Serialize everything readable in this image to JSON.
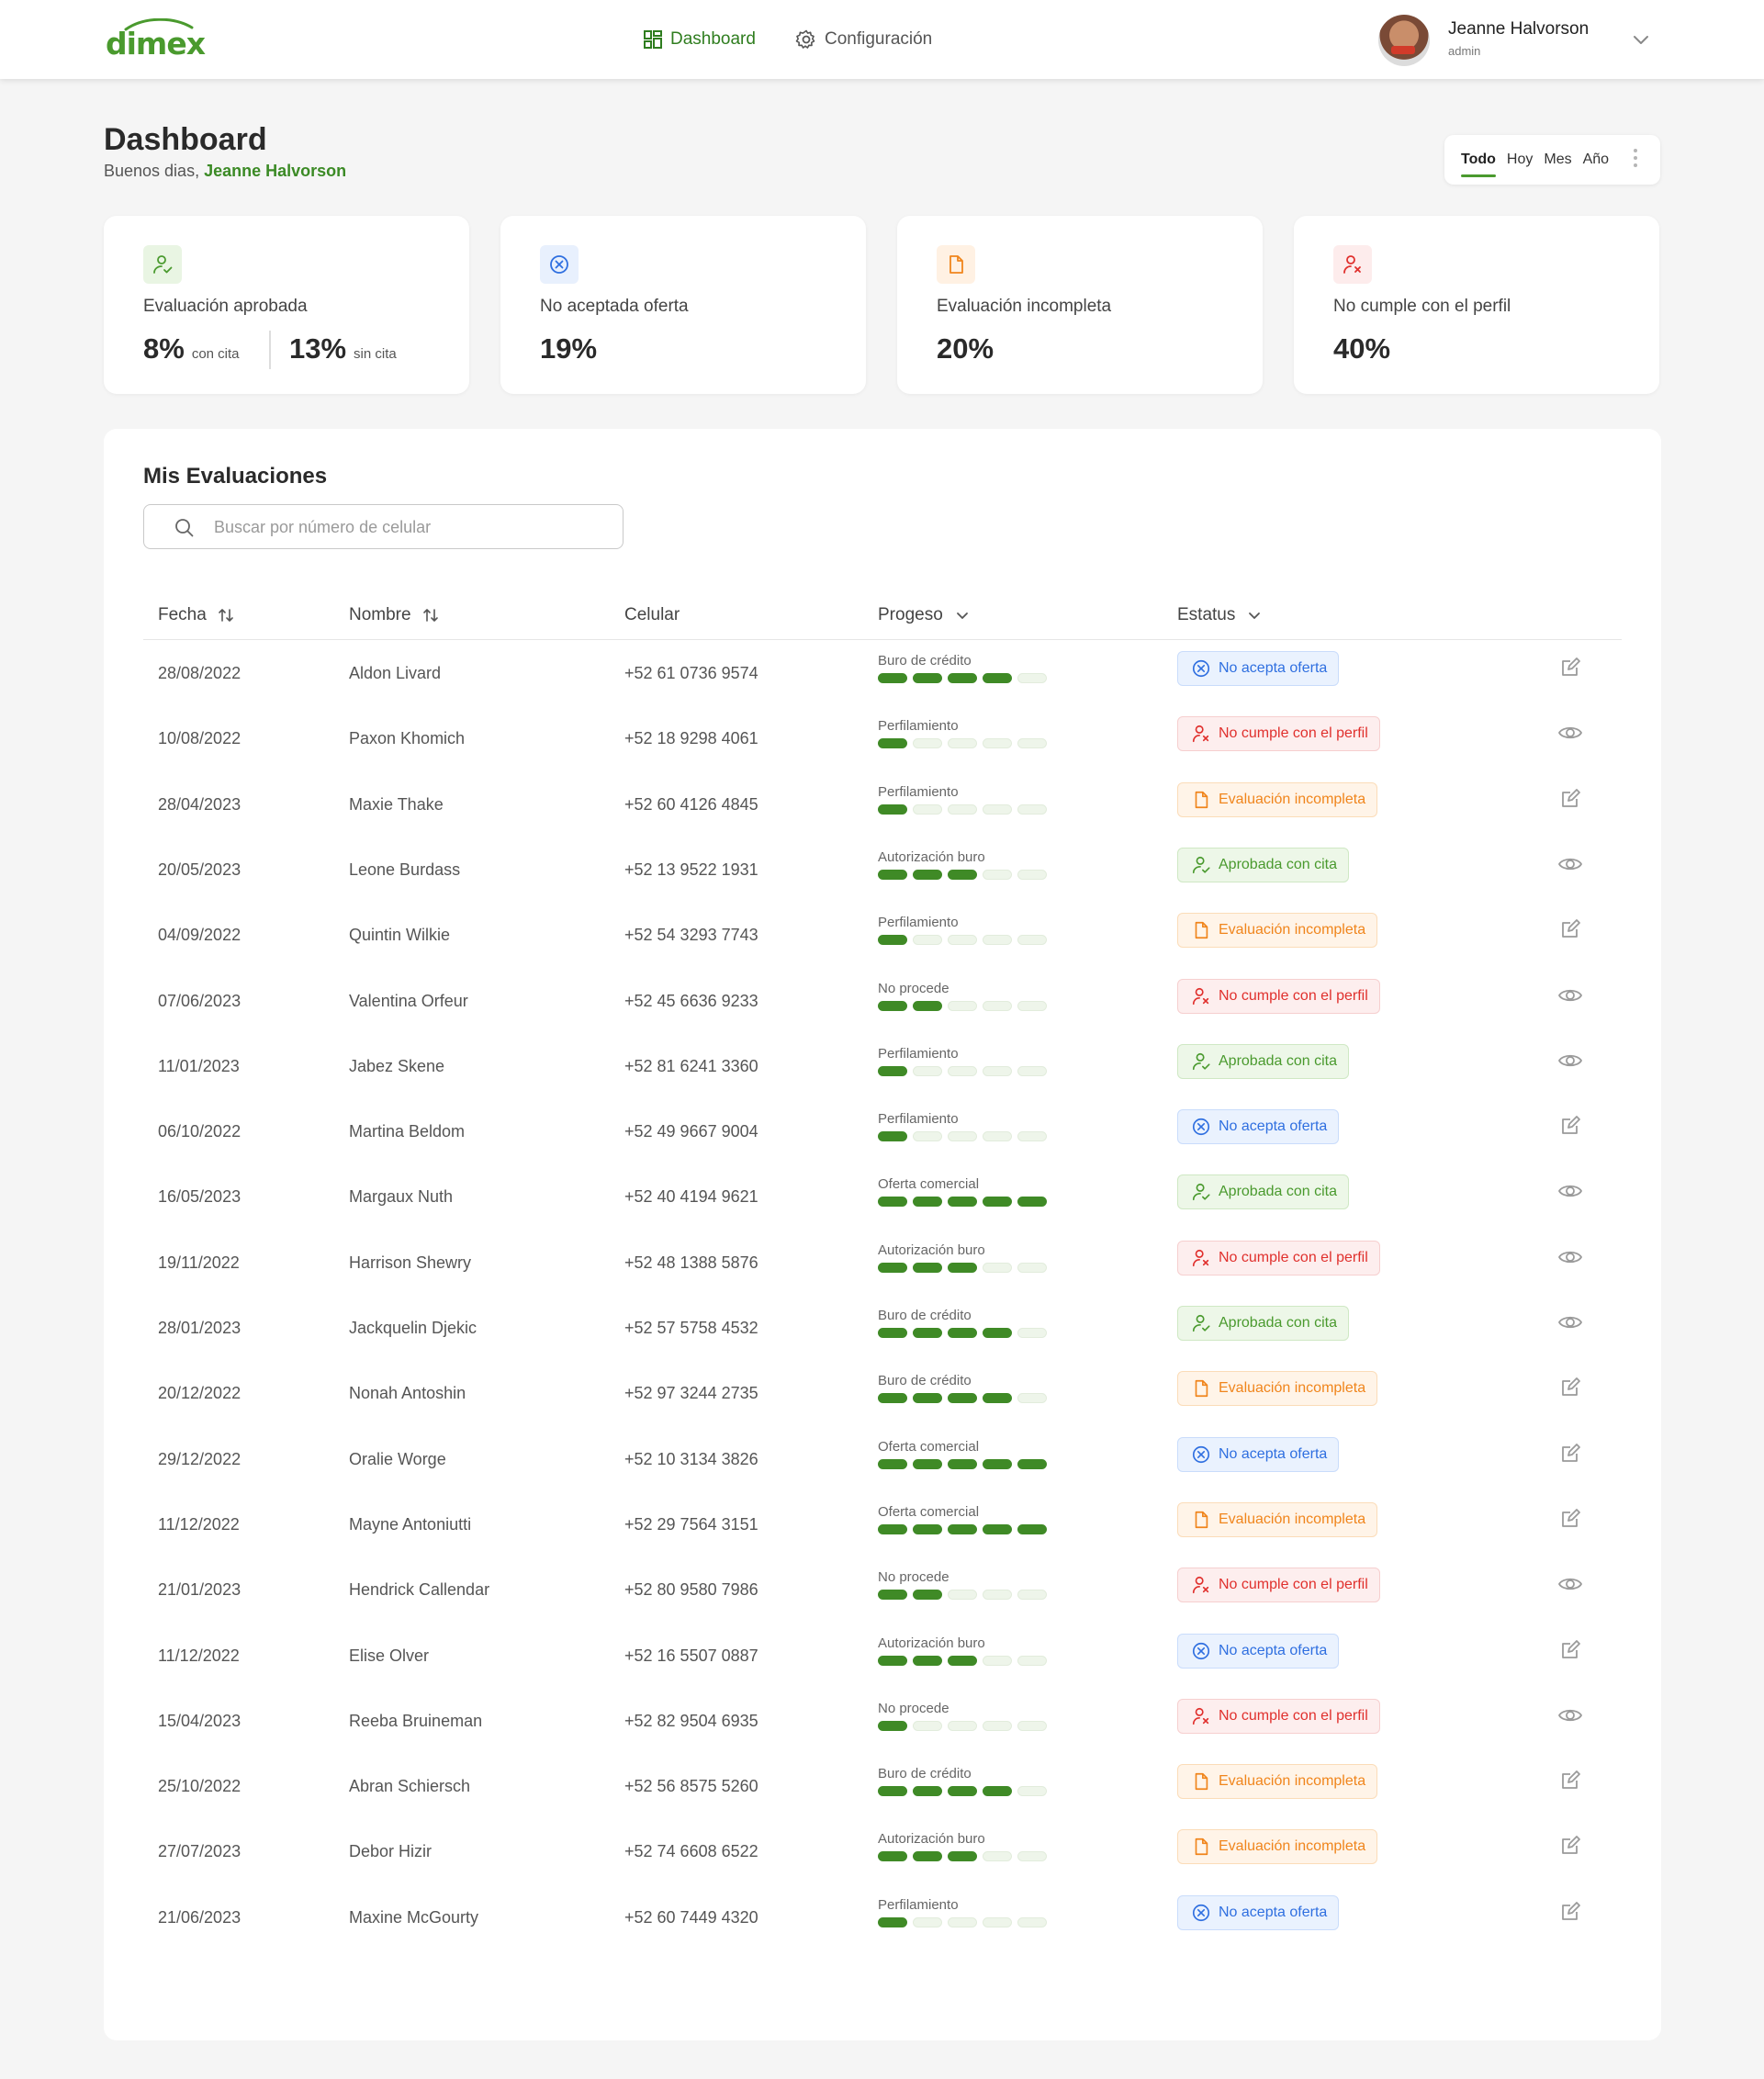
{
  "brand": {
    "name": "dimex",
    "color": "#4a9a2e"
  },
  "nav": {
    "items": [
      {
        "label": "Dashboard",
        "icon": "dashboard-grid-icon",
        "active": true
      },
      {
        "label": "Configuración",
        "icon": "gear-icon",
        "active": false
      }
    ]
  },
  "user": {
    "name": "Jeanne Halvorson",
    "role": "admin"
  },
  "header": {
    "title": "Dashboard",
    "greeting_prefix": "Buenos dias,",
    "greeting_name": "Jeanne Halvorson"
  },
  "period": {
    "options": [
      "Todo",
      "Hoy",
      "Mes",
      "Año"
    ],
    "selected": "Todo"
  },
  "stats": [
    {
      "label": "Evaluación aprobada",
      "icon": "user-check-icon",
      "color": "#4a9a2e",
      "value": "8%",
      "value_sub": "con cita",
      "value2": "13%",
      "value2_sub": "sin cita"
    },
    {
      "label": "No aceptada oferta",
      "icon": "x-circle-icon",
      "color": "#2f6fe0",
      "value": "19%"
    },
    {
      "label": "Evaluación incompleta",
      "icon": "document-icon",
      "color": "#f0851c",
      "value": "20%"
    },
    {
      "label": "No cumple con el perfil",
      "icon": "user-x-icon",
      "color": "#e0302d",
      "value": "40%"
    }
  ],
  "evaluations": {
    "title": "Mis Evaluaciones",
    "search_placeholder": "Buscar por número de celular",
    "columns": [
      "Fecha",
      "Nombre",
      "Celular",
      "Progeso",
      "Estatus"
    ],
    "progress_total_steps": 5,
    "rows": [
      {
        "fecha": "28/08/2022",
        "nombre": "Aldon Livard",
        "celular": "+52 61 0736 9574",
        "progreso": "Buro de crédito",
        "steps": 4,
        "estatus": "No acepta oferta",
        "tone": "blue",
        "action": "edit-icon"
      },
      {
        "fecha": "10/08/2022",
        "nombre": "Paxon Khomich",
        "celular": "+52 18 9298 4061",
        "progreso": "Perfilamiento",
        "steps": 1,
        "estatus": "No cumple con el perfil",
        "tone": "red",
        "action": "eye-icon"
      },
      {
        "fecha": "28/04/2023",
        "nombre": "Maxie Thake",
        "celular": "+52 60 4126 4845",
        "progreso": "Perfilamiento",
        "steps": 1,
        "estatus": "Evaluación incompleta",
        "tone": "orange",
        "action": "edit-icon"
      },
      {
        "fecha": "20/05/2023",
        "nombre": "Leone Burdass",
        "celular": "+52 13 9522 1931",
        "progreso": "Autorización buro",
        "steps": 3,
        "estatus": "Aprobada con cita",
        "tone": "green",
        "action": "eye-icon"
      },
      {
        "fecha": "04/09/2022",
        "nombre": "Quintin Wilkie",
        "celular": "+52 54 3293 7743",
        "progreso": "Perfilamiento",
        "steps": 1,
        "estatus": "Evaluación incompleta",
        "tone": "orange",
        "action": "edit-icon"
      },
      {
        "fecha": "07/06/2023",
        "nombre": "Valentina Orfeur",
        "celular": "+52 45 6636 9233",
        "progreso": "No procede",
        "steps": 2,
        "estatus": "No cumple con el perfil",
        "tone": "red",
        "action": "eye-icon"
      },
      {
        "fecha": "11/01/2023",
        "nombre": "Jabez Skene",
        "celular": "+52 81 6241 3360",
        "progreso": "Perfilamiento",
        "steps": 1,
        "estatus": "Aprobada con cita",
        "tone": "green",
        "action": "eye-icon"
      },
      {
        "fecha": "06/10/2022",
        "nombre": "Martina Beldom",
        "celular": "+52 49 9667 9004",
        "progreso": "Perfilamiento",
        "steps": 1,
        "estatus": "No acepta oferta",
        "tone": "blue",
        "action": "edit-icon"
      },
      {
        "fecha": "16/05/2023",
        "nombre": "Margaux Nuth",
        "celular": "+52 40 4194 9621",
        "progreso": "Oferta comercial",
        "steps": 5,
        "estatus": "Aprobada con cita",
        "tone": "green",
        "action": "eye-icon"
      },
      {
        "fecha": "19/11/2022",
        "nombre": "Harrison Shewry",
        "celular": "+52 48 1388 5876",
        "progreso": "Autorización buro",
        "steps": 3,
        "estatus": "No cumple con el perfil",
        "tone": "red",
        "action": "eye-icon"
      },
      {
        "fecha": "28/01/2023",
        "nombre": "Jackquelin Djekic",
        "celular": "+52 57 5758 4532",
        "progreso": "Buro de crédito",
        "steps": 4,
        "estatus": "Aprobada con cita",
        "tone": "green",
        "action": "eye-icon"
      },
      {
        "fecha": "20/12/2022",
        "nombre": "Nonah Antoshin",
        "celular": "+52 97 3244 2735",
        "progreso": "Buro de crédito",
        "steps": 4,
        "estatus": "Evaluación incompleta",
        "tone": "orange",
        "action": "edit-icon"
      },
      {
        "fecha": "29/12/2022",
        "nombre": "Oralie Worge",
        "celular": "+52 10 3134 3826",
        "progreso": "Oferta comercial",
        "steps": 5,
        "estatus": "No acepta oferta",
        "tone": "blue",
        "action": "edit-icon"
      },
      {
        "fecha": "11/12/2022",
        "nombre": "Mayne Antoniutti",
        "celular": "+52 29 7564 3151",
        "progreso": "Oferta comercial",
        "steps": 5,
        "estatus": "Evaluación incompleta",
        "tone": "orange",
        "action": "edit-icon"
      },
      {
        "fecha": "21/01/2023",
        "nombre": "Hendrick Callendar",
        "celular": "+52 80 9580 7986",
        "progreso": "No procede",
        "steps": 2,
        "estatus": "No cumple con el perfil",
        "tone": "red",
        "action": "eye-icon"
      },
      {
        "fecha": "11/12/2022",
        "nombre": "Elise Olver",
        "celular": "+52 16 5507 0887",
        "progreso": "Autorización buro",
        "steps": 3,
        "estatus": "No acepta oferta",
        "tone": "blue",
        "action": "edit-icon"
      },
      {
        "fecha": "15/04/2023",
        "nombre": "Reeba Bruineman",
        "celular": "+52 82 9504 6935",
        "progreso": "No procede",
        "steps": 1,
        "estatus": "No cumple con el perfil",
        "tone": "red",
        "action": "eye-icon"
      },
      {
        "fecha": "25/10/2022",
        "nombre": "Abran Schiersch",
        "celular": "+52 56 8575 5260",
        "progreso": "Buro de crédito",
        "steps": 4,
        "estatus": "Evaluación incompleta",
        "tone": "orange",
        "action": "edit-icon"
      },
      {
        "fecha": "27/07/2023",
        "nombre": "Debor Hizir",
        "celular": "+52 74 6608 6522",
        "progreso": "Autorización buro",
        "steps": 3,
        "estatus": "Evaluación incompleta",
        "tone": "orange",
        "action": "edit-icon"
      },
      {
        "fecha": "21/06/2023",
        "nombre": "Maxine McGourty",
        "celular": "+52 60 7449 4320",
        "progreso": "Perfilamiento",
        "steps": 1,
        "estatus": "No acepta oferta",
        "tone": "blue",
        "action": "edit-icon"
      }
    ]
  }
}
